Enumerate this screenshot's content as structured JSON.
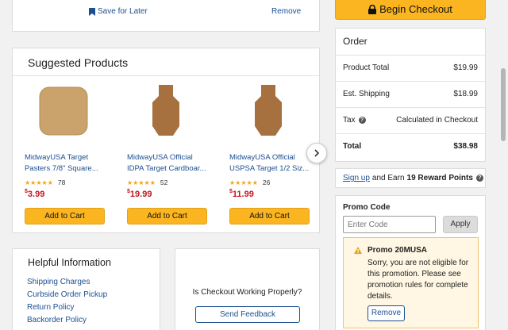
{
  "top_card": {
    "save_for_later": "Save for Later",
    "remove": "Remove"
  },
  "checkout": {
    "begin_label": "Begin Checkout"
  },
  "suggested": {
    "title": "Suggested Products",
    "products": [
      {
        "title_line1": "MidwayUSA Target",
        "title_line2": "Pasters 7/8\" Square...",
        "rating": 4.5,
        "reviews": "78",
        "price_sym": "$",
        "price": "3.99",
        "add_label": "Add to Cart"
      },
      {
        "title_line1": "MidwayUSA Official",
        "title_line2": "IDPA Target Cardboar...",
        "rating": 5,
        "reviews": "52",
        "price_sym": "$",
        "price": "19.99",
        "add_label": "Add to Cart"
      },
      {
        "title_line1": "MidwayUSA Official",
        "title_line2": "USPSA Target 1/2 Siz...",
        "rating": 4.5,
        "reviews": "26",
        "price_sym": "$",
        "price": "11.99",
        "add_label": "Add to Cart"
      }
    ]
  },
  "help": {
    "title": "Helpful Information",
    "links": [
      "Shipping Charges",
      "Curbside Order Pickup",
      "Return Policy",
      "Backorder Policy"
    ]
  },
  "feedback": {
    "question": "Is Checkout Working Properly?",
    "button": "Send Feedback"
  },
  "order": {
    "title": "Order",
    "rows": [
      {
        "label": "Product Total",
        "value": "$19.99"
      },
      {
        "label": "Est. Shipping",
        "value": "$18.99"
      },
      {
        "label": "Tax",
        "value": "Calculated in Checkout"
      }
    ],
    "total_label": "Total",
    "total_value": "$38.98"
  },
  "rewards": {
    "signup": "Sign up",
    "middle": "and Earn",
    "points": "19 Reward Points"
  },
  "promo": {
    "title": "Promo Code",
    "placeholder": "Enter Code",
    "apply": "Apply",
    "alert_title": "Promo 20MUSA",
    "alert_lines": [
      "Sorry, you are not eligible for",
      "this promotion. Please see",
      "promotion rules for complete",
      "details."
    ],
    "remove": "Remove"
  },
  "colors": {
    "accent_orange": "#fbb520",
    "link_blue": "#1d4f91",
    "price_red": "#c4161c",
    "alert_bg": "#fff7e3"
  }
}
